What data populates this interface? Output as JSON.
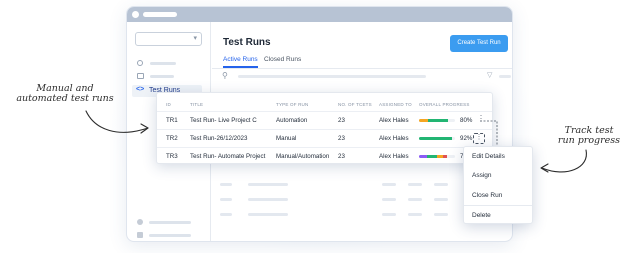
{
  "annotations": {
    "left_line1": "Manual and",
    "left_line2": "automated test runs",
    "right_line1": "Track test",
    "right_line2": "run progress"
  },
  "sidebar": {
    "active_label": "Test Runs",
    "active_icon": "code-brackets-icon"
  },
  "header": {
    "title": "Test Runs",
    "create_button": "Create Test Run"
  },
  "tabs": [
    {
      "label": "Active Runs",
      "active": true
    },
    {
      "label": "Closed Runs",
      "active": false
    }
  ],
  "table": {
    "columns": [
      "ID",
      "TITLE",
      "TYPE OF RUN",
      "NO. OF TCETS",
      "ASSIGNED TO",
      "OVERALL PROGRESS"
    ],
    "rows": [
      {
        "id": "TR1",
        "title": "Test Run- Live Project C",
        "type": "Automation",
        "count": "23",
        "assigned": "Alex Hales",
        "progress": "80%",
        "progress_value": 0.8
      },
      {
        "id": "TR2",
        "title": "Test Run-26/12/2023",
        "type": "Manual",
        "count": "23",
        "assigned": "Alex Hales",
        "progress": "92%",
        "progress_value": 0.92
      },
      {
        "id": "TR3",
        "title": "Test Run- Automate Project",
        "type": "Manual/Automation",
        "count": "23",
        "assigned": "Alex Hales",
        "progress": "79%",
        "progress_value": 0.79
      }
    ]
  },
  "context_menu": {
    "items": [
      "Edit Details",
      "Assign",
      "Close Run",
      "Delete"
    ]
  },
  "colors": {
    "accent": "#3b9cf0",
    "progress_orange": "#f5a623",
    "progress_green": "#22b573",
    "progress_purple": "#8b5cf6",
    "progress_red": "#e05252"
  }
}
